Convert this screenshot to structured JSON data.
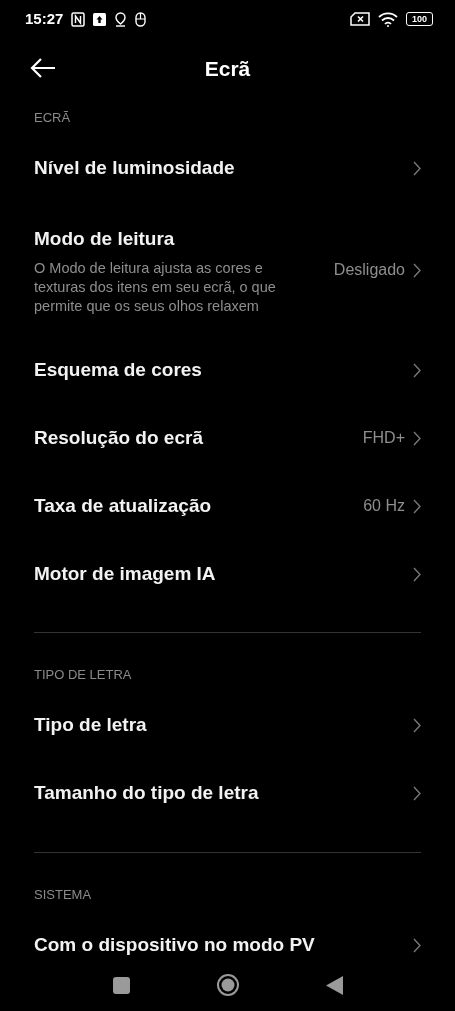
{
  "status_bar": {
    "time": "15:27",
    "battery": "100"
  },
  "header": {
    "title": "Ecrã"
  },
  "sections": [
    {
      "title": "ECRÃ",
      "items": [
        {
          "title": "Nível de luminosidade"
        },
        {
          "title": "Modo de leitura",
          "summary": "O Modo de leitura ajusta as cores e texturas dos itens em seu ecrã, o que permite que os seus olhos relaxem",
          "value": "Desligado"
        },
        {
          "title": "Esquema de cores"
        },
        {
          "title": "Resolução do ecrã",
          "value": "FHD+"
        },
        {
          "title": "Taxa de atualização",
          "value": "60 Hz"
        },
        {
          "title": "Motor de imagem IA"
        }
      ]
    },
    {
      "title": "TIPO DE LETRA",
      "items": [
        {
          "title": "Tipo de letra"
        },
        {
          "title": "Tamanho do tipo de letra"
        }
      ]
    },
    {
      "title": "SISTEMA",
      "items": [
        {
          "title": "Com o dispositivo no modo PV"
        }
      ]
    }
  ]
}
